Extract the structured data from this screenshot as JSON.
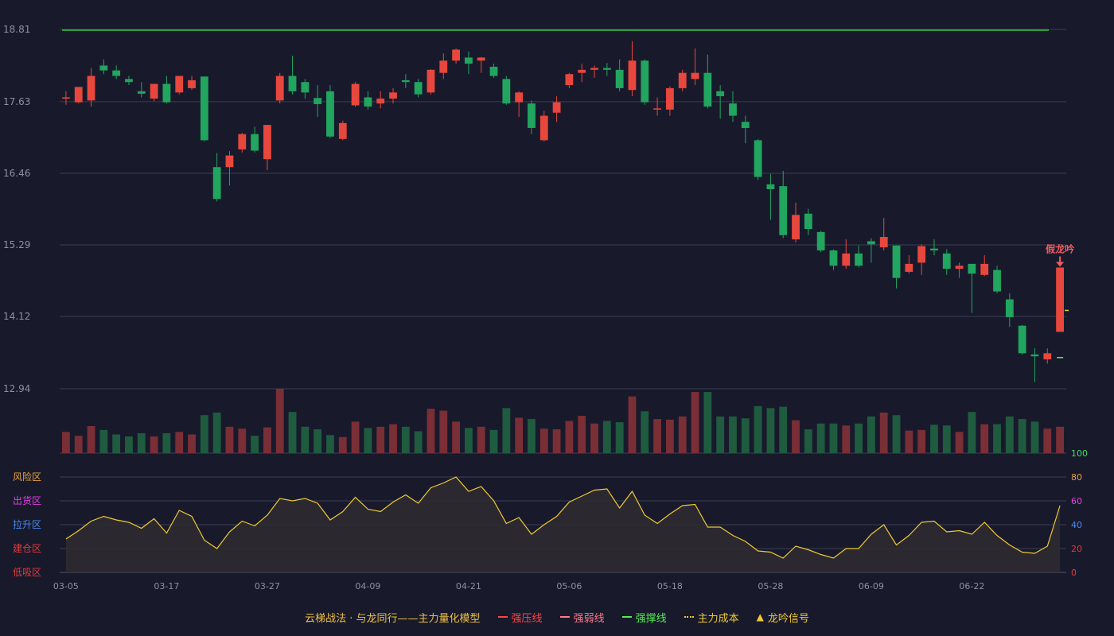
{
  "chart_data": {
    "type": "candlestick",
    "title": "",
    "price_axis": {
      "ticks": [
        18.81,
        17.63,
        16.46,
        15.29,
        14.12,
        12.94
      ]
    },
    "osc_axis": {
      "ticks": [
        100,
        80,
        60,
        40,
        20,
        0
      ]
    },
    "zones": [
      "风险区",
      "出货区",
      "拉升区",
      "建仓区",
      "低吸区"
    ],
    "zone_colors": [
      "#e8a23c",
      "#e040e0",
      "#4a8af0",
      "#e03a3a",
      "#e03a3a"
    ],
    "osc_tick_colors": [
      "#40e060",
      "#e8a23c",
      "#e040e0",
      "#4a8af0",
      "#e03a3a",
      "#e03a3a"
    ],
    "date_labels": [
      {
        "i": 0,
        "label": "03-05"
      },
      {
        "i": 8,
        "label": "03-17"
      },
      {
        "i": 16,
        "label": "03-27"
      },
      {
        "i": 24,
        "label": "04-09"
      },
      {
        "i": 32,
        "label": "04-21"
      },
      {
        "i": 40,
        "label": "05-06"
      },
      {
        "i": 48,
        "label": "05-18"
      },
      {
        "i": 56,
        "label": "05-28"
      },
      {
        "i": 64,
        "label": "06-09"
      },
      {
        "i": 72,
        "label": "06-22"
      }
    ],
    "candles": [
      [
        17.68,
        17.7,
        17.8,
        17.58
      ],
      [
        17.62,
        17.87,
        17.87,
        17.6
      ],
      [
        17.65,
        18.05,
        18.18,
        17.55
      ],
      [
        18.22,
        18.14,
        18.32,
        18.08
      ],
      [
        18.14,
        18.05,
        18.22,
        18.0
      ],
      [
        18.0,
        17.95,
        18.05,
        17.9
      ],
      [
        17.8,
        17.76,
        17.95,
        17.7
      ],
      [
        17.68,
        17.92,
        17.92,
        17.64
      ],
      [
        17.92,
        17.62,
        18.05,
        17.6
      ],
      [
        17.78,
        18.05,
        18.05,
        17.75
      ],
      [
        17.85,
        17.98,
        18.05,
        17.82
      ],
      [
        18.04,
        17.0,
        18.04,
        16.98
      ],
      [
        16.56,
        16.04,
        16.79,
        16.0
      ],
      [
        16.56,
        16.75,
        16.82,
        16.26
      ],
      [
        16.85,
        17.1,
        17.12,
        16.8
      ],
      [
        17.1,
        16.83,
        17.22,
        16.8
      ],
      [
        16.69,
        17.25,
        17.25,
        16.51
      ],
      [
        17.65,
        18.05,
        18.1,
        17.6
      ],
      [
        18.05,
        17.8,
        18.38,
        17.75
      ],
      [
        17.95,
        17.78,
        18.0,
        17.68
      ],
      [
        17.69,
        17.59,
        17.9,
        17.38
      ],
      [
        17.8,
        17.06,
        17.9,
        17.04
      ],
      [
        17.02,
        17.28,
        17.32,
        17.0
      ],
      [
        17.57,
        17.92,
        17.95,
        17.55
      ],
      [
        17.7,
        17.55,
        17.8,
        17.5
      ],
      [
        17.6,
        17.68,
        17.8,
        17.52
      ],
      [
        17.68,
        17.78,
        17.85,
        17.6
      ],
      [
        17.98,
        17.95,
        18.08,
        17.85
      ],
      [
        17.95,
        17.75,
        18.0,
        17.7
      ],
      [
        17.78,
        18.15,
        18.16,
        17.75
      ],
      [
        18.1,
        18.3,
        18.42,
        18.0
      ],
      [
        18.3,
        18.48,
        18.5,
        18.25
      ],
      [
        18.35,
        18.25,
        18.45,
        18.08
      ],
      [
        18.3,
        18.35,
        18.36,
        18.1
      ],
      [
        18.2,
        18.05,
        18.25,
        18.02
      ],
      [
        18.0,
        17.6,
        18.05,
        17.58
      ],
      [
        17.62,
        17.78,
        17.8,
        17.38
      ],
      [
        17.6,
        17.2,
        17.65,
        17.1
      ],
      [
        17.0,
        17.4,
        17.48,
        16.98
      ],
      [
        17.45,
        17.62,
        17.72,
        17.3
      ],
      [
        17.9,
        18.08,
        18.1,
        17.85
      ],
      [
        18.1,
        18.15,
        18.25,
        17.95
      ],
      [
        18.15,
        18.18,
        18.22,
        18.02
      ],
      [
        18.18,
        18.15,
        18.26,
        18.05
      ],
      [
        18.15,
        17.85,
        18.32,
        17.8
      ],
      [
        17.82,
        18.3,
        18.62,
        17.72
      ],
      [
        18.3,
        17.62,
        18.32,
        17.58
      ],
      [
        17.5,
        17.52,
        17.7,
        17.4
      ],
      [
        17.5,
        17.85,
        17.88,
        17.4
      ],
      [
        17.85,
        18.1,
        18.15,
        17.8
      ],
      [
        18.0,
        18.1,
        18.5,
        17.9
      ],
      [
        18.1,
        17.55,
        18.4,
        17.52
      ],
      [
        17.8,
        17.72,
        17.9,
        17.35
      ],
      [
        17.6,
        17.4,
        17.8,
        17.3
      ],
      [
        17.3,
        17.2,
        17.4,
        16.95
      ],
      [
        17.0,
        16.4,
        17.02,
        16.35
      ],
      [
        16.28,
        16.2,
        16.45,
        15.7
      ],
      [
        16.25,
        15.45,
        16.5,
        15.4
      ],
      [
        15.38,
        15.78,
        15.98,
        15.33
      ],
      [
        15.8,
        15.55,
        15.88,
        15.45
      ],
      [
        15.5,
        15.2,
        15.52,
        15.17
      ],
      [
        15.2,
        14.95,
        15.22,
        14.88
      ],
      [
        14.95,
        15.15,
        15.38,
        14.9
      ],
      [
        15.15,
        14.95,
        15.28,
        14.92
      ],
      [
        15.35,
        15.3,
        15.4,
        15.0
      ],
      [
        15.25,
        15.42,
        15.73,
        15.2
      ],
      [
        15.28,
        14.75,
        15.28,
        14.58
      ],
      [
        14.85,
        14.98,
        15.12,
        14.82
      ],
      [
        15.0,
        15.27,
        15.3,
        14.8
      ],
      [
        15.23,
        15.2,
        15.38,
        15.12
      ],
      [
        15.15,
        14.9,
        15.22,
        14.8
      ],
      [
        14.9,
        14.95,
        15.0,
        14.75
      ],
      [
        14.98,
        14.82,
        14.98,
        14.18
      ],
      [
        14.8,
        14.98,
        15.12,
        14.78
      ],
      [
        14.88,
        14.53,
        14.95,
        14.5
      ],
      [
        14.4,
        14.11,
        14.5,
        13.95
      ],
      [
        13.97,
        13.52,
        13.98,
        13.5
      ],
      [
        13.5,
        13.47,
        13.6,
        13.05
      ],
      [
        13.42,
        13.52,
        13.6,
        13.35
      ],
      [
        13.87,
        14.92,
        14.92,
        13.87
      ]
    ],
    "volumes": [
      0.33,
      0.27,
      0.42,
      0.36,
      0.29,
      0.26,
      0.31,
      0.26,
      0.31,
      0.33,
      0.29,
      0.59,
      0.63,
      0.41,
      0.38,
      0.27,
      0.4,
      1.0,
      0.64,
      0.41,
      0.37,
      0.28,
      0.25,
      0.49,
      0.39,
      0.41,
      0.45,
      0.41,
      0.34,
      0.69,
      0.66,
      0.49,
      0.39,
      0.41,
      0.36,
      0.7,
      0.55,
      0.53,
      0.38,
      0.37,
      0.5,
      0.58,
      0.46,
      0.5,
      0.48,
      0.88,
      0.65,
      0.53,
      0.52,
      0.57,
      0.95,
      0.95,
      0.57,
      0.57,
      0.54,
      0.73,
      0.7,
      0.72,
      0.51,
      0.37,
      0.46,
      0.46,
      0.43,
      0.46,
      0.57,
      0.63,
      0.59,
      0.35,
      0.36,
      0.44,
      0.43,
      0.33,
      0.64,
      0.45,
      0.45,
      0.57,
      0.53,
      0.49,
      0.38,
      0.41
    ],
    "oscillator": [
      28,
      35,
      43,
      47,
      44,
      42,
      37,
      45,
      33,
      52,
      47,
      27,
      20,
      34,
      43,
      39,
      48,
      62,
      60,
      62,
      58,
      44,
      51,
      63,
      53,
      51,
      59,
      65,
      58,
      71,
      75,
      80,
      68,
      72,
      60,
      41,
      46,
      32,
      40,
      47,
      59,
      64,
      69,
      70,
      54,
      68,
      48,
      41,
      49,
      56,
      57,
      38,
      38,
      31,
      26,
      18,
      17,
      12,
      22,
      19,
      15,
      12,
      20,
      20,
      32,
      40,
      23,
      31,
      42,
      43,
      34,
      35,
      32,
      42,
      31,
      23,
      17,
      16,
      22,
      56
    ],
    "strong_pressure_line": 18.81,
    "cost_ticks": [
      [
        79,
        14.22
      ]
    ],
    "strong_support_marks": [
      [
        79,
        13.45
      ]
    ],
    "signals": [
      {
        "i": 79,
        "label": "假龙吟"
      }
    ],
    "colors": {
      "up": "#e8473d",
      "down": "#21a55f",
      "vol_up": "#7a2e35",
      "vol_down": "#1f5b3f",
      "pressure": "#45e04a",
      "osc": "#f0c833",
      "osc_fill": "#2e2b30",
      "grid": "#3a3d52",
      "axis_text": "#8d90a3",
      "signal": "#f05c60",
      "cost": "#f0c833"
    }
  },
  "legend": {
    "title": "云梯战法 · 与龙同行——主力量化模型",
    "items": [
      {
        "label": "强压线",
        "color": "#ff4444",
        "style": "solid"
      },
      {
        "label": "强弱线",
        "color": "#ff7a8a",
        "style": "dash"
      },
      {
        "label": "强撑线",
        "color": "#55ee55",
        "style": "solid"
      },
      {
        "label": "主力成本",
        "color": "#f0c833",
        "style": "dot"
      },
      {
        "label": "龙吟信号",
        "color": "#f0c833",
        "style": "tri",
        "symbol": "▲"
      }
    ]
  }
}
